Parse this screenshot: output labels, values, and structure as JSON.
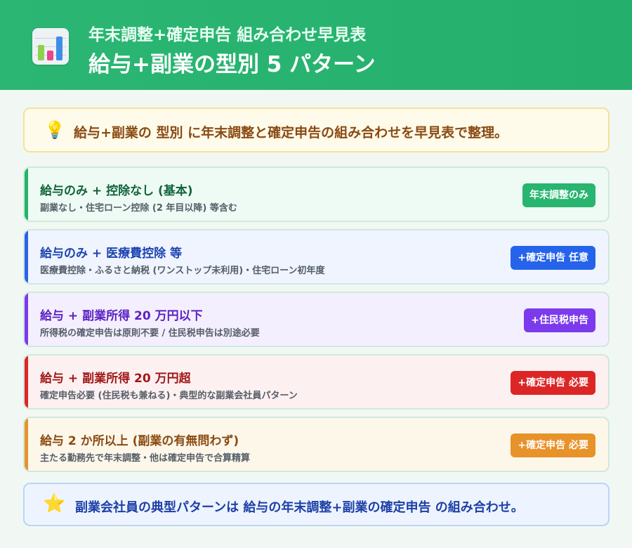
{
  "header": {
    "icon": "bar-chart-icon",
    "subtitle": "年末調整+確定申告 組み合わせ早見表",
    "title": "給与+副業の型別 5 パターン"
  },
  "tip": {
    "icon": "light-bulb-icon",
    "text": "給与+副業の 型別 に年末調整と確定申告の組み合わせを早見表で整理。"
  },
  "cards": [
    {
      "title": "給与のみ + 控除なし (基本)",
      "desc": "副業なし・住宅ローン控除 (2 年目以降) 等含む",
      "badge": "年末調整のみ",
      "color": "#27b56f"
    },
    {
      "title": "給与のみ + 医療費控除 等",
      "desc": "医療費控除・ふるさと納税 (ワンストップ未利用)・住宅ローン初年度",
      "badge": "+確定申告 任意",
      "color": "#2563eb"
    },
    {
      "title": "給与 + 副業所得 20 万円以下",
      "desc": "所得税の確定申告は原則不要 / 住民税申告は別途必要",
      "badge": "+住民税申告",
      "color": "#7c3aed"
    },
    {
      "title": "給与 + 副業所得 20 万円超",
      "desc": "確定申告必要 (住民税も兼ねる)・典型的な副業会社員パターン",
      "badge": "+確定申告 必要",
      "color": "#dc2626"
    },
    {
      "title": "給与 2 か所以上 (副業の有無問わず)",
      "desc": "主たる勤務先で年末調整・他は確定申告で合算精算",
      "badge": "+確定申告 必要",
      "color": "#e8922a"
    }
  ],
  "footer": {
    "icon": "star-icon",
    "text": "副業会社員の典型パターンは 給与の年末調整+副業の確定申告 の組み合わせ。"
  }
}
